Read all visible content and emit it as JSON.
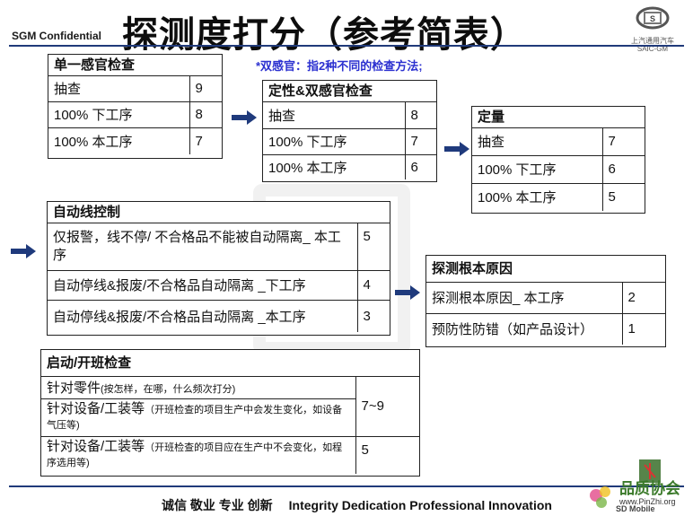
{
  "header": {
    "confidential": "SGM Confidential",
    "title": "探测度打分（参考简表）",
    "logo_line1": "上汽通用汽车",
    "logo_line2": "SAIC-GM"
  },
  "note": "*双感官：指2种不同的检查方法;",
  "single_sense": {
    "title": "单一感官检查",
    "rows": [
      {
        "label": "抽查",
        "value": "9"
      },
      {
        "label": "100% 下工序",
        "value": "8"
      },
      {
        "label": "100% 本工序",
        "value": "7"
      }
    ]
  },
  "qualitative": {
    "title": "定性&双感官检查",
    "rows": [
      {
        "label": "抽查",
        "value": "8"
      },
      {
        "label": "100% 下工序",
        "value": "7"
      },
      {
        "label": "100% 本工序",
        "value": "6"
      }
    ]
  },
  "quantitative": {
    "title": "定量",
    "rows": [
      {
        "label": "抽查",
        "value": "7"
      },
      {
        "label": "100% 下工序",
        "value": "6"
      },
      {
        "label": "100% 本工序",
        "value": "5"
      }
    ]
  },
  "auto_line": {
    "title": "自动线控制",
    "rows": [
      {
        "label": "仅报警，线不停/ 不合格品不能被自动隔离_ 本工序",
        "value": "5"
      },
      {
        "label": "自动停线&报废/不合格品自动隔离 _下工序",
        "value": "4"
      },
      {
        "label": "自动停线&报废/不合格品自动隔离 _本工序",
        "value": "3"
      }
    ]
  },
  "root_cause": {
    "title": "探测根本原因",
    "rows": [
      {
        "label": "探测根本原因_ 本工序",
        "value": "2"
      },
      {
        "label": "预防性防错（如产品设计）",
        "value": "1"
      }
    ]
  },
  "startup": {
    "title": "启动/开班检查",
    "rows": [
      {
        "label": "针对零件",
        "note": "(按怎样，在哪，什么频次打分)"
      },
      {
        "label": "针对设备/工装等",
        "note": "（开班检查的项目生产中会发生变化，如设备气压等)"
      },
      {
        "label": "针对设备/工装等",
        "note": "（开班检查的项目应在生产中不会变化，如程序选用等)"
      }
    ],
    "value_group": "7~9",
    "value_last": "5"
  },
  "footer": {
    "cn": "诚信 敬业 专业 创新",
    "en": "Integrity  Dedication  Professional  Innovation"
  },
  "watermark": {
    "corner_text": "SD Mobile",
    "corner_site": "www.PinZhi.org"
  },
  "colors": {
    "arrow": "#1f3a7c",
    "rule": "#203a7a",
    "note": "#2c31d0"
  }
}
